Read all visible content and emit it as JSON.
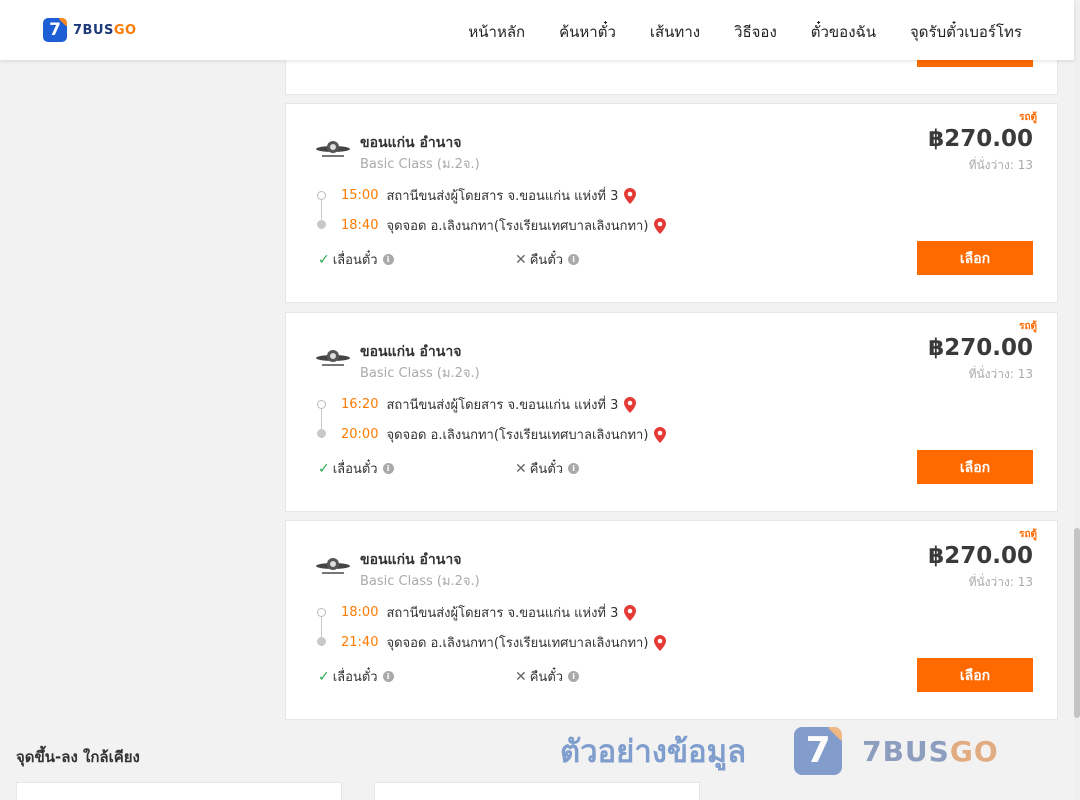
{
  "header": {
    "logo_number": "7",
    "logo_bus": "BUS",
    "logo_go": "GO",
    "nav": [
      "หน้าหลัก",
      "ค้นหาตั๋ว",
      "เส้นทาง",
      "วิธีจอง",
      "ตั๋วของฉัน",
      "จุดรับตั๋วเบอร์โทร"
    ]
  },
  "trips": [
    {
      "operator": "ขอนแก่น อำนาจ",
      "class": "Basic Class (ม.2จ.)",
      "vehicle": "รถตู้",
      "price": "฿270.00",
      "seats": "ที่นั่งว่าง: 13",
      "dep_time": "15:00",
      "dep_place": "สถานีขนส่งผู้โดยสาร จ.ขอนแก่น แห่งที่ 3",
      "arr_time": "18:40",
      "arr_place": "จุดจอด อ.เลิงนกทา(โรงเรียนเทศบาลเลิงนกทา)",
      "change": "เลื่อนตั๋ว",
      "refund": "คืนตั๋ว",
      "select": "เลือก"
    },
    {
      "operator": "ขอนแก่น อำนาจ",
      "class": "Basic Class (ม.2จ.)",
      "vehicle": "รถตู้",
      "price": "฿270.00",
      "seats": "ที่นั่งว่าง: 13",
      "dep_time": "16:20",
      "dep_place": "สถานีขนส่งผู้โดยสาร จ.ขอนแก่น แห่งที่ 3",
      "arr_time": "20:00",
      "arr_place": "จุดจอด อ.เลิงนกทา(โรงเรียนเทศบาลเลิงนกทา)",
      "change": "เลื่อนตั๋ว",
      "refund": "คืนตั๋ว",
      "select": "เลือก"
    },
    {
      "operator": "ขอนแก่น อำนาจ",
      "class": "Basic Class (ม.2จ.)",
      "vehicle": "รถตู้",
      "price": "฿270.00",
      "seats": "ที่นั่งว่าง: 13",
      "dep_time": "18:00",
      "dep_place": "สถานีขนส่งผู้โดยสาร จ.ขอนแก่น แห่งที่ 3",
      "arr_time": "21:40",
      "arr_place": "จุดจอด อ.เลิงนกทา(โรงเรียนเทศบาลเลิงนกทา)",
      "change": "เลื่อนตั๋ว",
      "refund": "คืนตั๋ว",
      "select": "เลือก"
    }
  ],
  "nearby": {
    "title": "จุดขึ้น-ลง ใกล้เคียง"
  },
  "watermark": {
    "text": "ตัวอย่างข้อมูล",
    "badge": "7",
    "brand_bus": "7BUS",
    "brand_go": "GO"
  },
  "colors": {
    "accent": "#ff6a00",
    "brand_blue": "#1e5fd6",
    "time": "#ff7a00",
    "check": "#2ea84a"
  }
}
